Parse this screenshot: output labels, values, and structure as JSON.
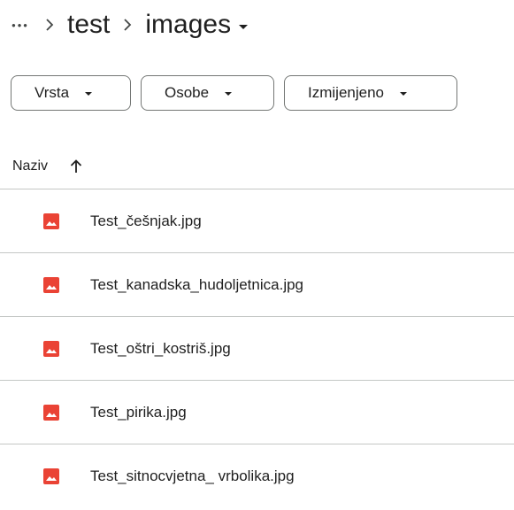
{
  "breadcrumb": {
    "more_label": "•••",
    "separator": "›",
    "items": [
      {
        "label": "test"
      },
      {
        "label": "images"
      }
    ]
  },
  "filters": [
    {
      "label": "Vrsta"
    },
    {
      "label": "Osobe"
    },
    {
      "label": "Izmijenjeno"
    }
  ],
  "list": {
    "header": {
      "name_label": "Naziv",
      "sort_direction": "ascending"
    },
    "rows": [
      {
        "name": "Test_češnjak.jpg",
        "icon": "image-file-icon"
      },
      {
        "name": "Test_kanadska_hudoljetnica.jpg",
        "icon": "image-file-icon"
      },
      {
        "name": "Test_oštri_kostriš.jpg",
        "icon": "image-file-icon"
      },
      {
        "name": "Test_pirika.jpg",
        "icon": "image-file-icon"
      },
      {
        "name": "Test_sitnocvjetna_ vrbolika.jpg",
        "icon": "image-file-icon"
      }
    ]
  },
  "colors": {
    "image_icon": "#ea4335",
    "text": "#1f1f1f",
    "divider": "#c4c7c5",
    "chip_border": "#747775"
  }
}
